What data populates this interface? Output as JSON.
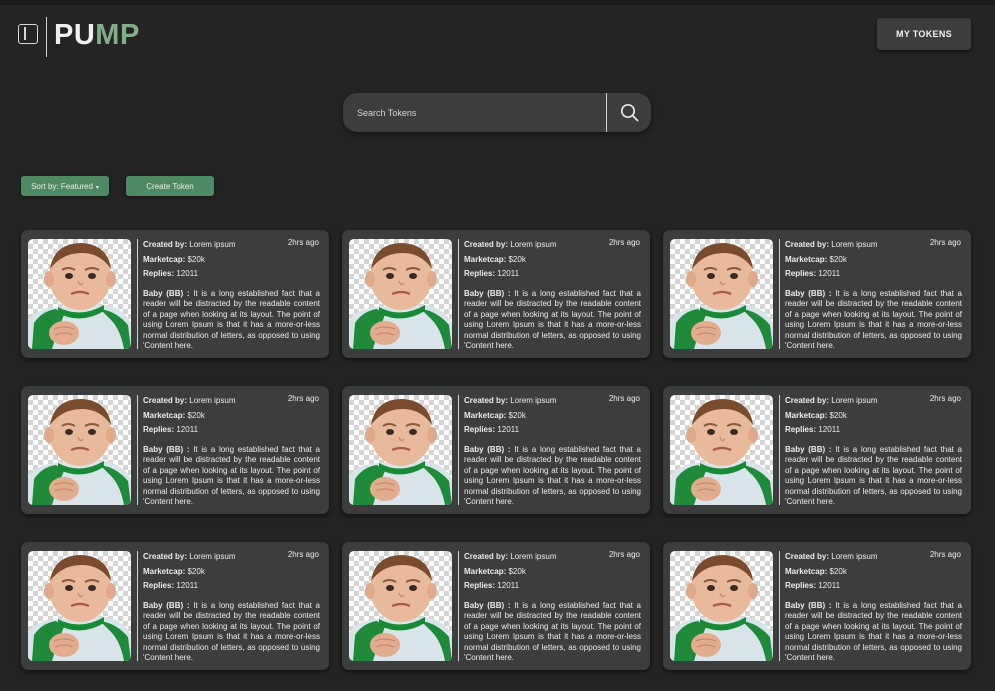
{
  "header": {
    "logo_part1": "PU",
    "logo_part2": "MP",
    "my_tokens_label": "MY TOKENS"
  },
  "search": {
    "placeholder": "Search Tokens"
  },
  "controls": {
    "sort_label": "Sort by: Featured",
    "create_label": "Create Token"
  },
  "colors": {
    "background": "#242424",
    "card": "#3c3e3d",
    "accent_green": "#4e8a63",
    "logo_green": "#7fae88"
  },
  "cards": [
    {
      "created_label": "Created by:",
      "created_value": "Lorem ipsum",
      "mcap_label": "Marketcap:",
      "mcap_value": "$20k",
      "replies_label": "Replies:",
      "replies_value": "12011",
      "time": "2hrs ago",
      "token_name": "Baby (BB) :",
      "description": "It is a long established fact that a reader will be distracted by the  readable content of a page when looking at its layout. The point of  using Lorem Ipsum is  that it has a more-or-less normal distribution of letters, as opposed to using 'Content here."
    },
    {
      "created_label": "Created by:",
      "created_value": "Lorem ipsum",
      "mcap_label": "Marketcap:",
      "mcap_value": "$20k",
      "replies_label": "Replies:",
      "replies_value": "12011",
      "time": "2hrs ago",
      "token_name": "Baby (BB) :",
      "description": "It is a long established fact that a reader will be distracted by the  readable content of a page when looking at its layout. The point of  using Lorem Ipsum is  that it has a more-or-less normal distribution of letters, as opposed to using 'Content here."
    },
    {
      "created_label": "Created by:",
      "created_value": "Lorem ipsum",
      "mcap_label": "Marketcap:",
      "mcap_value": "$20k",
      "replies_label": "Replies:",
      "replies_value": "12011",
      "time": "2hrs ago",
      "token_name": "Baby (BB) :",
      "description": "It is a long established fact that a reader will be distracted by the  readable content of a page when looking at its layout. The point of  using Lorem Ipsum is  that it has a more-or-less normal distribution of letters, as opposed to using 'Content here."
    },
    {
      "created_label": "Created by:",
      "created_value": "Lorem ipsum",
      "mcap_label": "Marketcap:",
      "mcap_value": "$20k",
      "replies_label": "Replies:",
      "replies_value": "12011",
      "time": "2hrs ago",
      "token_name": "Baby (BB) :",
      "description": "It is a long established fact that a reader will be distracted by the  readable content of a page when looking at its layout. The point of  using Lorem Ipsum is  that it has a more-or-less normal distribution of letters, as opposed to using 'Content here."
    },
    {
      "created_label": "Created by:",
      "created_value": "Lorem ipsum",
      "mcap_label": "Marketcap:",
      "mcap_value": "$20k",
      "replies_label": "Replies:",
      "replies_value": "12011",
      "time": "2hrs ago",
      "token_name": "Baby (BB) :",
      "description": "It is a long established fact that a reader will be distracted by the  readable content of a page when looking at its layout. The point of  using Lorem Ipsum is  that it has a more-or-less normal distribution of letters, as opposed to using 'Content here."
    },
    {
      "created_label": "Created by:",
      "created_value": "Lorem ipsum",
      "mcap_label": "Marketcap:",
      "mcap_value": "$20k",
      "replies_label": "Replies:",
      "replies_value": "12011",
      "time": "2hrs ago",
      "token_name": "Baby (BB) :",
      "description": "It is a long established fact that a reader will be distracted by the  readable content of a page when looking at its layout. The point of  using Lorem Ipsum is  that it has a more-or-less normal distribution of letters, as opposed to using 'Content here."
    },
    {
      "created_label": "Created by:",
      "created_value": "Lorem ipsum",
      "mcap_label": "Marketcap:",
      "mcap_value": "$20k",
      "replies_label": "Replies:",
      "replies_value": "12011",
      "time": "2hrs ago",
      "token_name": "Baby (BB) :",
      "description": "It is a long established fact that a reader will be distracted by the  readable content of a page when looking at its layout. The point of  using Lorem Ipsum is  that it has a more-or-less normal distribution of letters, as opposed to using 'Content here."
    },
    {
      "created_label": "Created by:",
      "created_value": "Lorem ipsum",
      "mcap_label": "Marketcap:",
      "mcap_value": "$20k",
      "replies_label": "Replies:",
      "replies_value": "12011",
      "time": "2hrs ago",
      "token_name": "Baby (BB) :",
      "description": "It is a long established fact that a reader will be distracted by the  readable content of a page when looking at its layout. The point of  using Lorem Ipsum is  that it has a more-or-less normal distribution of letters, as opposed to using 'Content here."
    },
    {
      "created_label": "Created by:",
      "created_value": "Lorem ipsum",
      "mcap_label": "Marketcap:",
      "mcap_value": "$20k",
      "replies_label": "Replies:",
      "replies_value": "12011",
      "time": "2hrs ago",
      "token_name": "Baby (BB) :",
      "description": "It is a long established fact that a reader will be distracted by the  readable content of a page when looking at its layout. The point of  using Lorem Ipsum is  that it has a more-or-less normal distribution of letters, as opposed to using 'Content here."
    }
  ]
}
